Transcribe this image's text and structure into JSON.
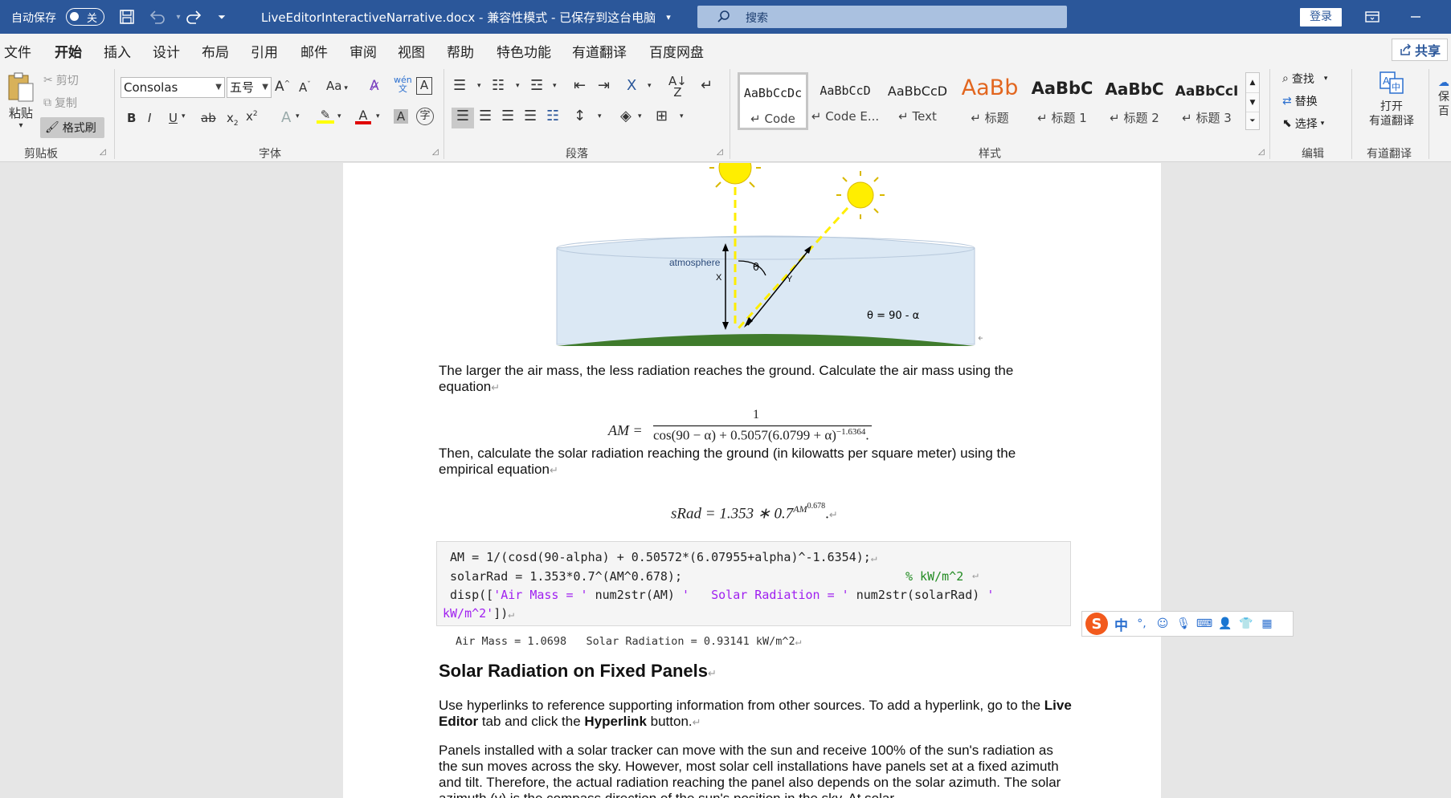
{
  "titlebar": {
    "autosave_label": "自动保存",
    "autosave_state": "关",
    "doc_title": "LiveEditorInteractiveNarrative.docx  -  兼容性模式  -  已保存到这台电脑",
    "search_placeholder": "搜索",
    "login_label": "登录"
  },
  "menu": {
    "tabs": [
      "文件",
      "开始",
      "插入",
      "设计",
      "布局",
      "引用",
      "邮件",
      "审阅",
      "视图",
      "帮助",
      "特色功能",
      "有道翻译",
      "百度网盘"
    ],
    "active_tab": "开始",
    "share_label": "共享"
  },
  "ribbon": {
    "clipboard": {
      "paste": "粘贴",
      "cut": "剪切",
      "copy": "复制",
      "format_painter": "格式刷",
      "group": "剪贴板"
    },
    "font": {
      "family": "Consolas",
      "size": "五号",
      "change_case": "Aa",
      "group": "字体"
    },
    "paragraph": {
      "group": "段落"
    },
    "styles": {
      "group": "样式",
      "items": [
        {
          "sample": "AaBbCcDc",
          "name": "Code"
        },
        {
          "sample": "AaBbCcD",
          "name": "Code E..."
        },
        {
          "sample": "AaBbCcD",
          "name": "Text"
        },
        {
          "sample": "AaBb",
          "name": "标题"
        },
        {
          "sample": "AaBbC",
          "name": "标题 1"
        },
        {
          "sample": "AaBbC",
          "name": "标题 2"
        },
        {
          "sample": "AaBbCcI",
          "name": "标题 3"
        }
      ]
    },
    "editing": {
      "find": "查找",
      "replace": "替换",
      "select": "选择",
      "group": "编辑"
    },
    "youdao": {
      "open": "打开",
      "open2": "有道翻译",
      "group": "有道翻译"
    },
    "extra": {
      "label1": "保",
      "label2": "百"
    }
  },
  "document": {
    "figure": {
      "atmosphere_label": "atmosphere",
      "x_label": "X",
      "y_label": "Y",
      "theta_label": "θ",
      "formula_label": "θ = 90 - α"
    },
    "para1": "The larger the air mass, the less radiation reaches the ground. Calculate the air mass using the equation",
    "eq1": {
      "lhs": "AM =",
      "numerator": "1",
      "denominator": "cos(90 − α) + 0.5057(6.0799 + α)",
      "exponent": "−1.6364",
      "end": "."
    },
    "para2": "Then, calculate the solar radiation reaching the ground (in kilowatts per square meter) using the empirical equation",
    "eq2": {
      "text": "sRad = 1.353 ∗ 0.7",
      "exp_base": "AM",
      "exp_power": "0.678",
      "end": "."
    },
    "code": {
      "line1": "AM = 1/(cosd(90-alpha) + 0.50572*(6.07955+alpha)^-1.6354);",
      "line2_code": "solarRad = 1.353*0.7^(AM^0.678);",
      "line2_comment": "% kW/m^2",
      "line3_a": "disp([",
      "line3_s1": "'Air Mass = '",
      "line3_b": " num2str(AM) ",
      "line3_s2": "'   Solar Radiation = '",
      "line3_c": " num2str(solarRad) ",
      "line3_s3": "'",
      "line4_s": "kW/m^2'",
      "line4_end": "])"
    },
    "output": "Air Mass = 1.0698   Solar Radiation = 0.93141 kW/m^2",
    "heading": "Solar Radiation on Fixed Panels",
    "para3_a": "Use hyperlinks to reference supporting information from other sources. To add a hyperlink, go to the ",
    "para3_b": "Live Editor",
    "para3_c": " tab and click the ",
    "para3_d": "Hyperlink",
    "para3_e": " button.",
    "para4": "Panels installed with a solar tracker can move with the sun and receive 100% of the sun's radiation as the sun moves across the sky.  However, most solar cell installations have panels set at a fixed azimuth and tilt. Therefore, the actual radiation reaching the panel also depends on the solar azimuth. The solar azimuth (γ) is the compass direction of the sun's position in the sky. At solar"
  },
  "ime": {
    "lang": "中",
    "punct": "°,"
  }
}
